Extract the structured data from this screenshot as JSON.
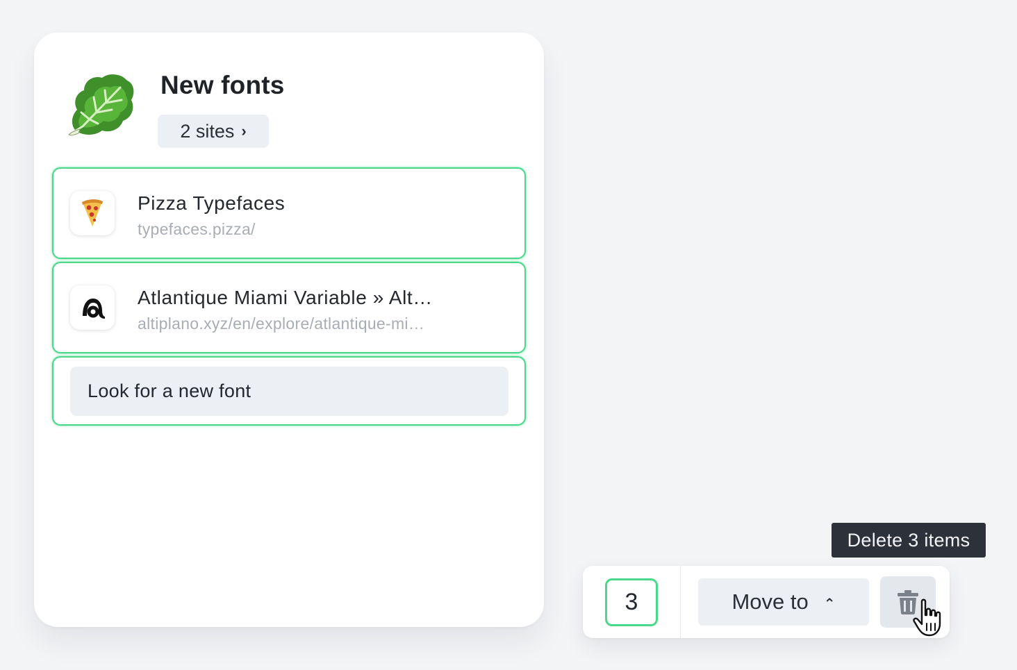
{
  "folder": {
    "emoji_icon": "leafy-green-icon",
    "title": "New fonts",
    "sites_label": "2 sites",
    "sites_chevron": "›"
  },
  "items": [
    {
      "title": "Pizza Typefaces",
      "url": "typefaces.pizza/",
      "icon": "pizza-slice-icon"
    },
    {
      "title": "Atlantique Miami Variable » Alt…",
      "url": "altiplano.xyz/en/explore/atlantique-mi…",
      "icon": "altiplano-a-icon"
    }
  ],
  "new_font_button": "Look for a new font",
  "selection_bar": {
    "count": "3",
    "move_label": "Move to",
    "move_caret": "⌃",
    "delete_icon": "trash-icon",
    "tooltip": "Delete 3 items"
  },
  "colors": {
    "selection_border": "#4ad98a",
    "background": "#f3f4f6",
    "tooltip_bg": "#2d3139"
  }
}
